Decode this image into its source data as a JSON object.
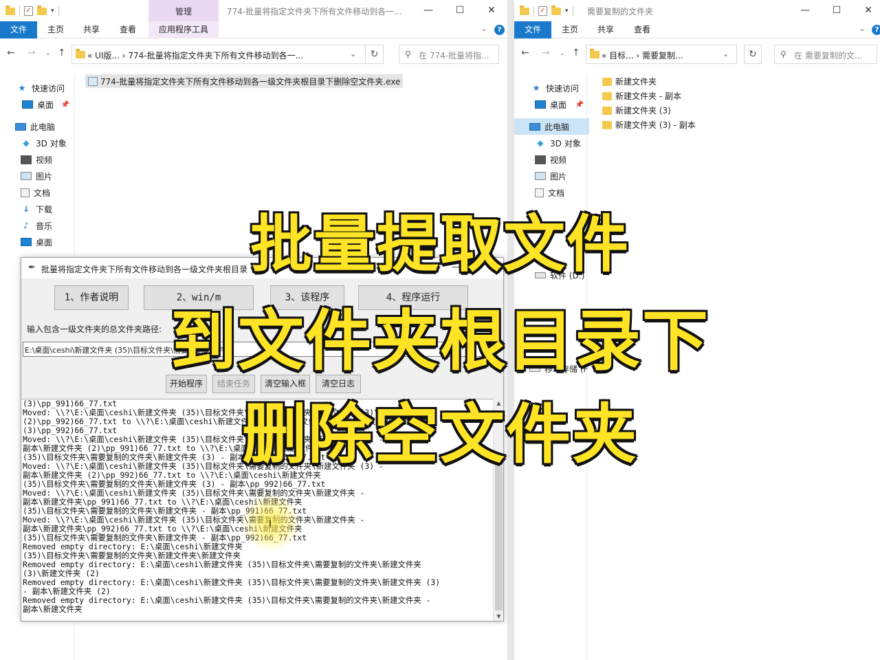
{
  "left_window": {
    "title": "774-批量将指定文件夹下所有文件移动到各一...",
    "manage_tab": "管理",
    "ribbon_tabs": [
      "文件",
      "主页",
      "共享",
      "查看",
      "应用程序工具"
    ],
    "address": "«  UI版...  ›  774-批量将指定文件夹下所有文件移动到各一...",
    "search_placeholder": "在 774-批量将指...",
    "selected_file": "774-批量将指定文件夹下所有文件移动到各一级文件夹根目录下删除空文件夹.exe",
    "nav_items": [
      {
        "label": "快速访问",
        "icon": "star-icon"
      },
      {
        "label": "桌面",
        "icon": "desktop-icon",
        "pinned": true
      },
      {
        "label": "此电脑",
        "icon": "computer-icon"
      },
      {
        "label": "3D 对象",
        "icon": "cube-icon"
      },
      {
        "label": "视频",
        "icon": "video-icon"
      },
      {
        "label": "图片",
        "icon": "picture-icon"
      },
      {
        "label": "文档",
        "icon": "document-icon"
      },
      {
        "label": "下载",
        "icon": "download-icon"
      },
      {
        "label": "音乐",
        "icon": "music-icon"
      },
      {
        "label": "桌面",
        "icon": "desktop-icon"
      }
    ]
  },
  "right_window": {
    "title": "需要复制的文件夹",
    "ribbon_tabs": [
      "文件",
      "主页",
      "共享",
      "查看"
    ],
    "address": "«  目标...  ›  需要复制...",
    "search_placeholder": "在 需要复制的文...",
    "nav_items": [
      {
        "label": "快速访问",
        "icon": "star-icon"
      },
      {
        "label": "桌面",
        "icon": "desktop-icon",
        "pinned": true
      },
      {
        "label": "此电脑",
        "icon": "computer-icon"
      },
      {
        "label": "3D 对象",
        "icon": "cube-icon"
      },
      {
        "label": "视频",
        "icon": "video-icon"
      },
      {
        "label": "图片",
        "icon": "picture-icon"
      },
      {
        "label": "文档",
        "icon": "document-icon"
      }
    ],
    "drive_items": [
      {
        "label": "软件 (D:)",
        "icon": "drive-icon"
      },
      {
        "label": "移动存储 (F",
        "icon": "drive-icon"
      }
    ],
    "folders": [
      "新建文件夹",
      "新建文件夹 - 副本",
      "新建文件夹 (3)",
      "新建文件夹 (3) - 副本"
    ]
  },
  "dialog": {
    "title": "批量将指定文件夹下所有文件移动到各一级文件夹根目录",
    "top_buttons": [
      "1、作者说明",
      "2、win/m",
      "3、该程序",
      "4、程序运行"
    ],
    "path_label": "输入包含一级文件夹的总文件夹路径:",
    "path_value": "E:\\桌面\\ceshi\\新建文件夹 (35)\\目标文件夹\\需要复制的文件夹",
    "action_buttons": [
      "开始程序",
      "结束任务",
      "清空输入框",
      "清空日志"
    ],
    "log_lines": [
      "(3)\\pp_991)66_77.txt",
      "Moved: \\\\?\\E:\\桌面\\ceshi\\新建文件夹 (35)\\目标文件夹\\需要复制的文件夹\\新建文件夹 (3)\\新建文件夹",
      "(2)\\pp_992)66_77.txt to \\\\?\\E:\\桌面\\ceshi\\新建文件夹 (35)\\目标文件夹\\需要复制的文件夹\\新建文件夹",
      "(3)\\pp_992)66_77.txt",
      "Moved: \\\\?\\E:\\桌面\\ceshi\\新建文件夹 (35)\\目标文件夹\\需要复制的文件夹\\新建文件夹 (3) -",
      "副本\\新建文件夹 (2)\\pp_991)66_77.txt to \\\\?\\E:\\桌面\\ceshi\\新建文件夹",
      "(35)\\目标文件夹\\需要复制的文件夹\\新建文件夹 (3) - 副本\\pp_991)66_77.txt",
      "Moved: \\\\?\\E:\\桌面\\ceshi\\新建文件夹 (35)\\目标文件夹\\需要复制的文件夹\\新建文件夹 (3) -",
      "副本\\新建文件夹 (2)\\pp_992)66_77.txt to \\\\?\\E:\\桌面\\ceshi\\新建文件夹",
      "(35)\\目标文件夹\\需要复制的文件夹\\新建文件夹 (3) - 副本\\pp_992)66_77.txt",
      "Moved: \\\\?\\E:\\桌面\\ceshi\\新建文件夹 (35)\\目标文件夹\\需要复制的文件夹\\新建文件夹 -",
      "副本\\新建文件夹\\pp_991)66_77.txt to \\\\?\\E:\\桌面\\ceshi\\新建文件夹",
      "(35)\\目标文件夹\\需要复制的文件夹\\新建文件夹 - 副本\\pp_991)66_77.txt",
      "Moved: \\\\?\\E:\\桌面\\ceshi\\新建文件夹 (35)\\目标文件夹\\需要复制的文件夹\\新建文件夹 -",
      "副本\\新建文件夹\\pp_992)66_77.txt to \\\\?\\E:\\桌面\\ceshi\\新建文件夹",
      "(35)\\目标文件夹\\需要复制的文件夹\\新建文件夹 - 副本\\pp_992)66_77.txt",
      "Removed empty directory: E:\\桌面\\ceshi\\新建文件夹",
      "(35)\\目标文件夹\\需要复制的文件夹\\新建文件夹\\新建文件夹",
      "Removed empty directory: E:\\桌面\\ceshi\\新建文件夹 (35)\\目标文件夹\\需要复制的文件夹\\新建文件夹",
      "(3)\\新建文件夹 (2)",
      "Removed empty directory: E:\\桌面\\ceshi\\新建文件夹 (35)\\目标文件夹\\需要复制的文件夹\\新建文件夹 (3)",
      "- 副本\\新建文件夹 (2)",
      "Removed empty directory: E:\\桌面\\ceshi\\新建文件夹 (35)\\目标文件夹\\需要复制的文件夹\\新建文件夹 -",
      "副本\\新建文件夹"
    ]
  },
  "caption": {
    "line1": "批量提取文件",
    "line2": "到文件夹根目录下",
    "line3": "删除空文件夹"
  },
  "colors": {
    "ribbon_file_tab": "#1979ca",
    "manage_tab": "#e9d9f3",
    "caption_fill": "#ffe426",
    "caption_stroke": "#111111",
    "cursor_highlight": "#ffec3c"
  }
}
